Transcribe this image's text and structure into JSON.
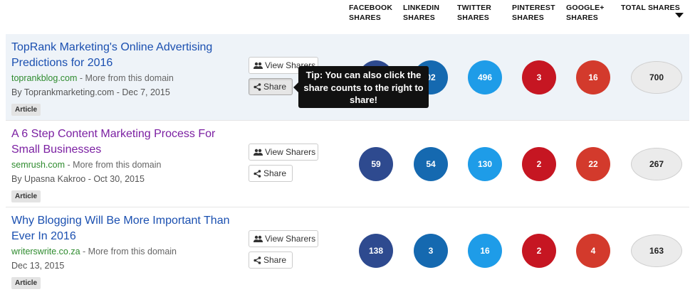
{
  "header": {
    "columns": [
      {
        "label": "FACEBOOK\nSHARES"
      },
      {
        "label": "LINKEDIN\nSHARES"
      },
      {
        "label": "TWITTER\nSHARES"
      },
      {
        "label": "PINTEREST\nSHARES"
      },
      {
        "label": "GOOGLE+\nSHARES"
      },
      {
        "label": "TOTAL SHARES"
      }
    ]
  },
  "colors": {
    "facebook": "#2e4a8f",
    "linkedin": "#1569b0",
    "twitter": "#1e9ce8",
    "pinterest": "#c61622",
    "googleplus": "#d33a2c",
    "title_link": "#1a4fb0",
    "title_visited": "#7b1fa2",
    "domain_link": "#2e8b2e"
  },
  "buttons": {
    "view_sharers_label": "View Sharers",
    "share_label": "Share",
    "view_sharers_icon": "users-icon",
    "share_icon": "share-icon"
  },
  "tooltip": {
    "text": "Tip: You can also click the share counts to the right to share!"
  },
  "rows": [
    {
      "title": "TopRank Marketing's Online Advertising Predictions for 2016",
      "domain": "toprankblog.com",
      "more": " - More from this domain",
      "byline": "By Toprankmarketing.com - Dec 7, 2015",
      "badge": "Article",
      "facebook": "",
      "linkedin": "02",
      "twitter": "496",
      "pinterest": "3",
      "googleplus": "16",
      "total": "700"
    },
    {
      "title": "A 6 Step Content Marketing Process For Small Businesses",
      "domain": "semrush.com",
      "more": " - More from this domain",
      "byline": "By Upasna Kakroo - Oct 30, 2015",
      "badge": "Article",
      "facebook": "59",
      "linkedin": "54",
      "twitter": "130",
      "pinterest": "2",
      "googleplus": "22",
      "total": "267"
    },
    {
      "title": "Why Blogging Will Be More Important Than Ever In 2016",
      "domain": "writerswrite.co.za",
      "more": " - More from this domain",
      "byline": "Dec 13, 2015",
      "badge": "Article",
      "facebook": "138",
      "linkedin": "3",
      "twitter": "16",
      "pinterest": "2",
      "googleplus": "4",
      "total": "163"
    }
  ]
}
